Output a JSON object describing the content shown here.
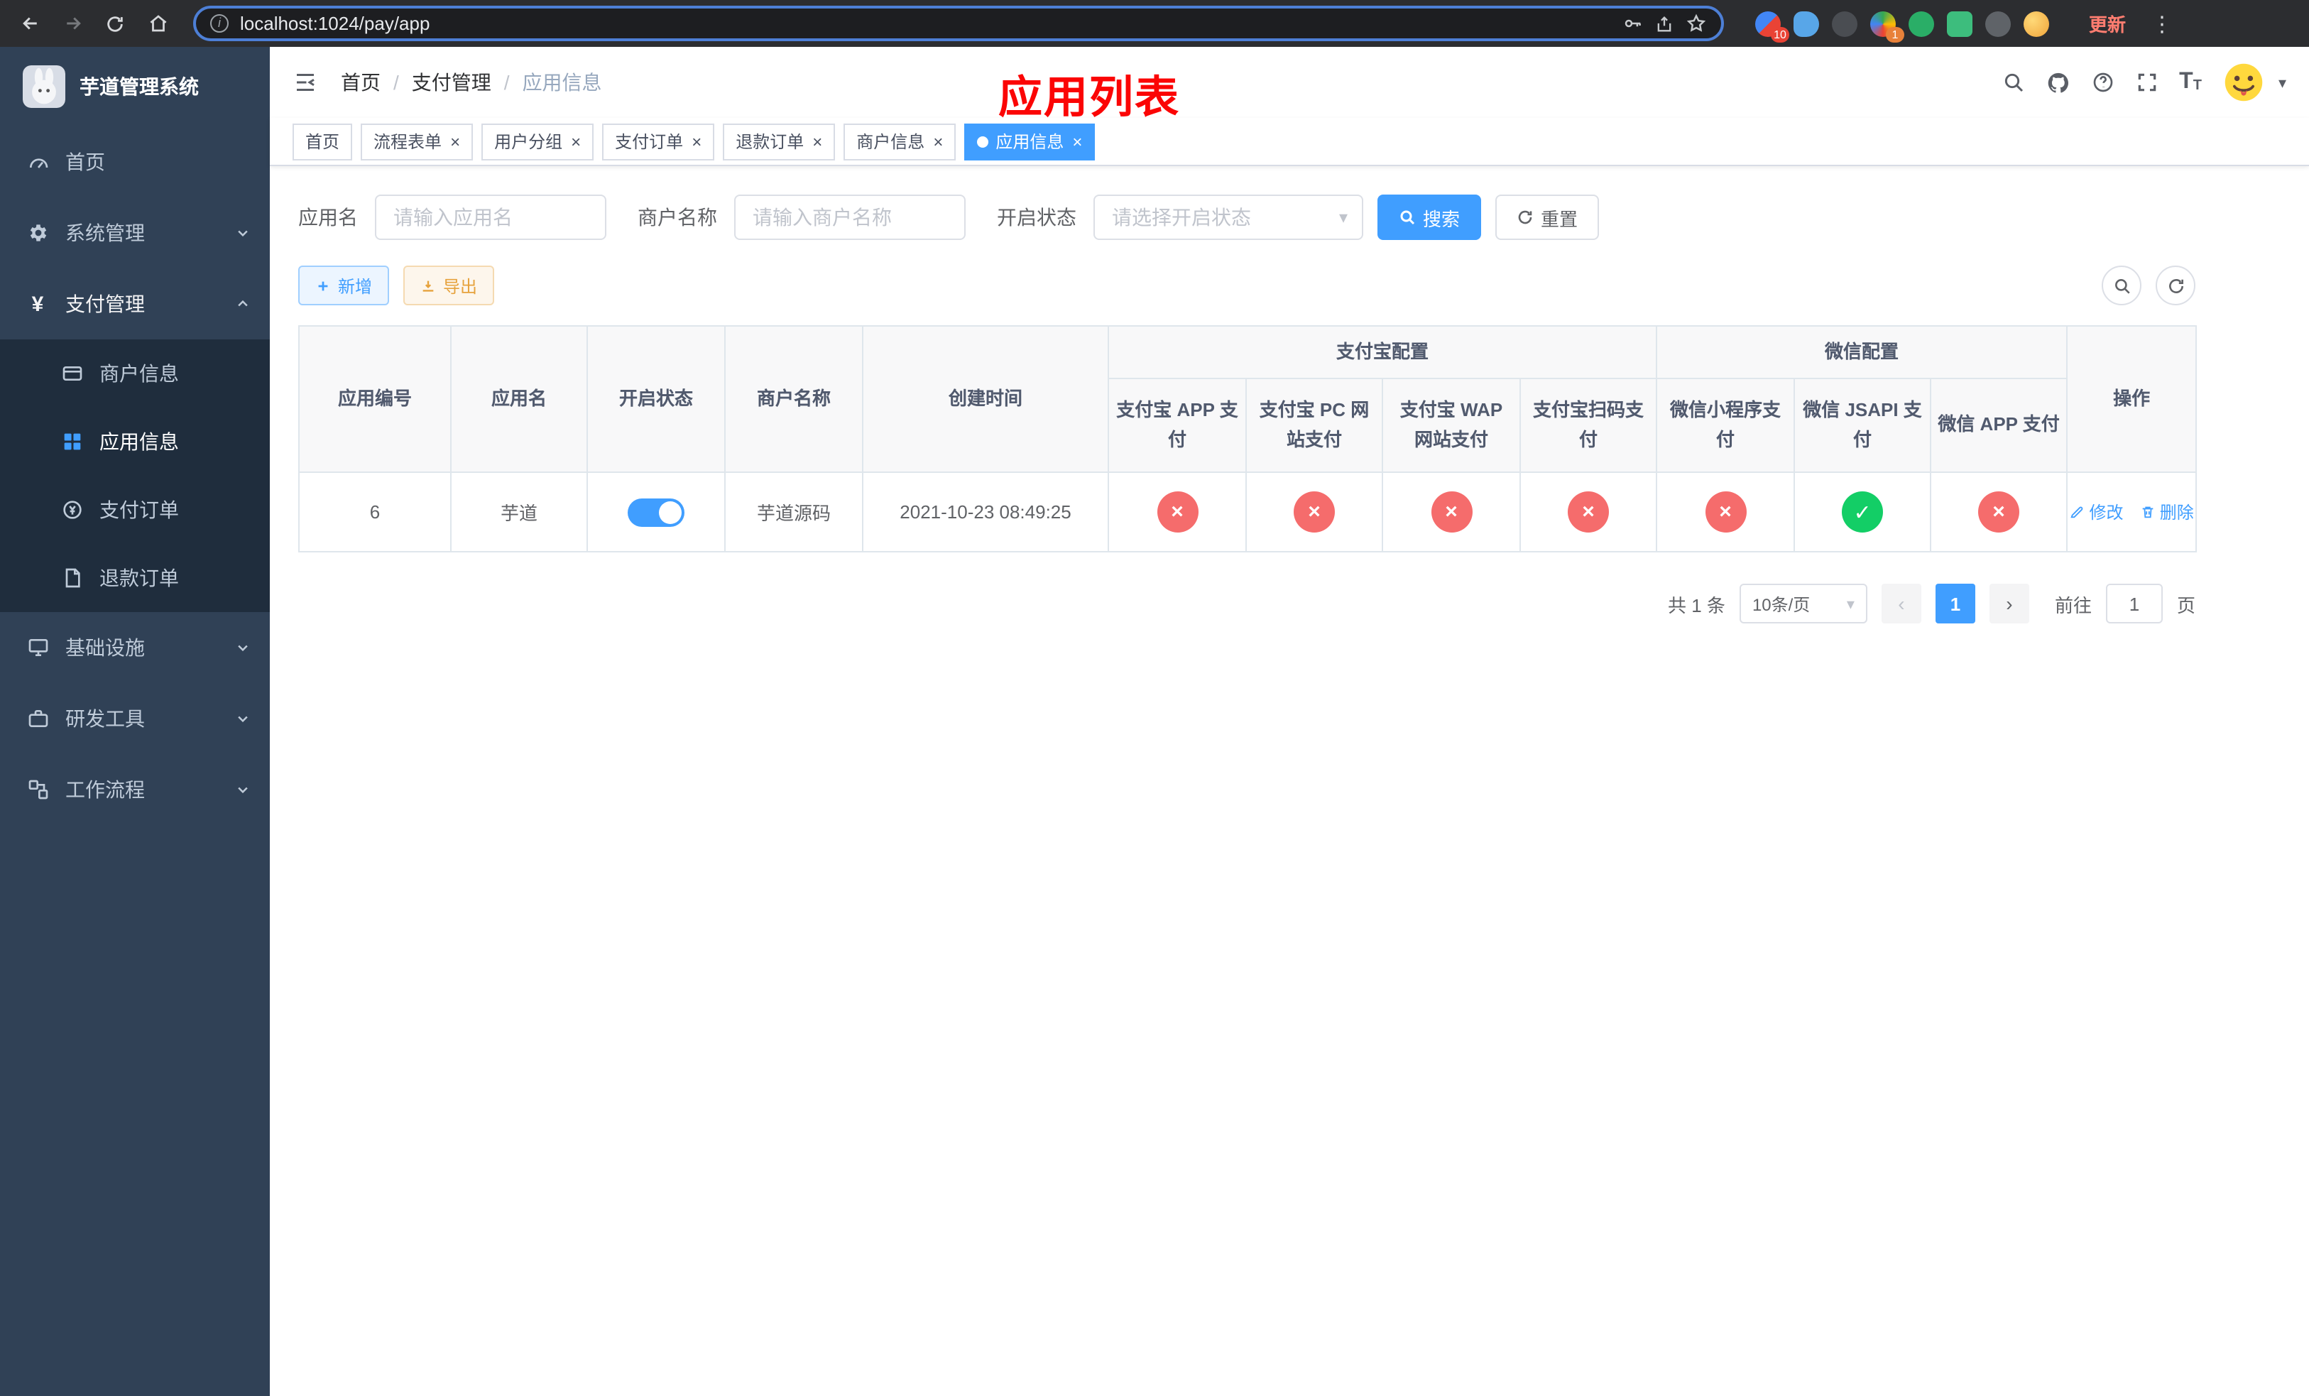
{
  "browser": {
    "url": "localhost:1024/pay/app",
    "update_label": "更新",
    "ext_badge_red": "10",
    "ext_badge_orange": "1"
  },
  "icons": {
    "close": "×",
    "cross": "×",
    "check": "✓",
    "caret": "▾",
    "menu_dots": "⋮",
    "info": "i",
    "yen": "¥",
    "letter_t": "T",
    "prev": "‹",
    "next": "›",
    "slash": "/"
  },
  "sidebar": {
    "logo_title": "芋道管理系统",
    "items": [
      {
        "label": "首页"
      },
      {
        "label": "系统管理"
      },
      {
        "label": "支付管理"
      },
      {
        "label": "基础设施"
      },
      {
        "label": "研发工具"
      },
      {
        "label": "工作流程"
      }
    ],
    "payment_children": [
      {
        "label": "商户信息"
      },
      {
        "label": "应用信息",
        "active": true
      },
      {
        "label": "支付订单"
      },
      {
        "label": "退款订单"
      }
    ]
  },
  "header": {
    "breadcrumb": [
      "首页",
      "支付管理",
      "应用信息"
    ],
    "annotation": "应用列表"
  },
  "tabs": [
    {
      "label": "首页",
      "closable": false,
      "active": false
    },
    {
      "label": "流程表单",
      "closable": true,
      "active": false
    },
    {
      "label": "用户分组",
      "closable": true,
      "active": false
    },
    {
      "label": "支付订单",
      "closable": true,
      "active": false
    },
    {
      "label": "退款订单",
      "closable": true,
      "active": false
    },
    {
      "label": "商户信息",
      "closable": true,
      "active": false
    },
    {
      "label": "应用信息",
      "closable": true,
      "active": true
    }
  ],
  "filters": {
    "app_name_label": "应用名",
    "app_name_placeholder": "请输入应用名",
    "merchant_label": "商户名称",
    "merchant_placeholder": "请输入商户名称",
    "status_label": "开启状态",
    "status_placeholder": "请选择开启状态",
    "search_label": "搜索",
    "reset_label": "重置"
  },
  "toolbar": {
    "add_label": "新增",
    "export_label": "导出"
  },
  "table": {
    "group_alipay": "支付宝配置",
    "group_wechat": "微信配置",
    "col_id": "应用编号",
    "col_name": "应用名",
    "col_status": "开启状态",
    "col_merchant": "商户名称",
    "col_created": "创建时间",
    "col_alipay_app": "支付宝 APP 支付",
    "col_alipay_pc": "支付宝 PC 网站支付",
    "col_alipay_wap": "支付宝 WAP 网站支付",
    "col_alipay_qr": "支付宝扫码支付",
    "col_wx_lite": "微信小程序支付",
    "col_wx_jsapi": "微信 JSAPI 支付",
    "col_wx_app": "微信 APP 支付",
    "col_actions": "操作",
    "row": {
      "id": "6",
      "name": "芋道",
      "enabled": true,
      "merchant": "芋道源码",
      "created": "2021-10-23 08:49:25",
      "alipay_app": false,
      "alipay_pc": false,
      "alipay_wap": false,
      "alipay_qr": false,
      "wx_lite": false,
      "wx_jsapi": true,
      "wx_app": false,
      "edit_label": "修改",
      "delete_label": "删除"
    }
  },
  "pagination": {
    "total_label": "共 1 条",
    "page_size_label": "10条/页",
    "current_page": "1",
    "goto_label": "前往",
    "goto_value": "1",
    "page_unit": "页"
  },
  "colors": {
    "accent": "#409eff",
    "success": "#13ce66",
    "danger": "#f56c6c",
    "sidebar_bg": "#304156",
    "submenu_bg": "#1f2d3d",
    "tab_active": "#409eff",
    "annotation_red": "#fb0505"
  }
}
